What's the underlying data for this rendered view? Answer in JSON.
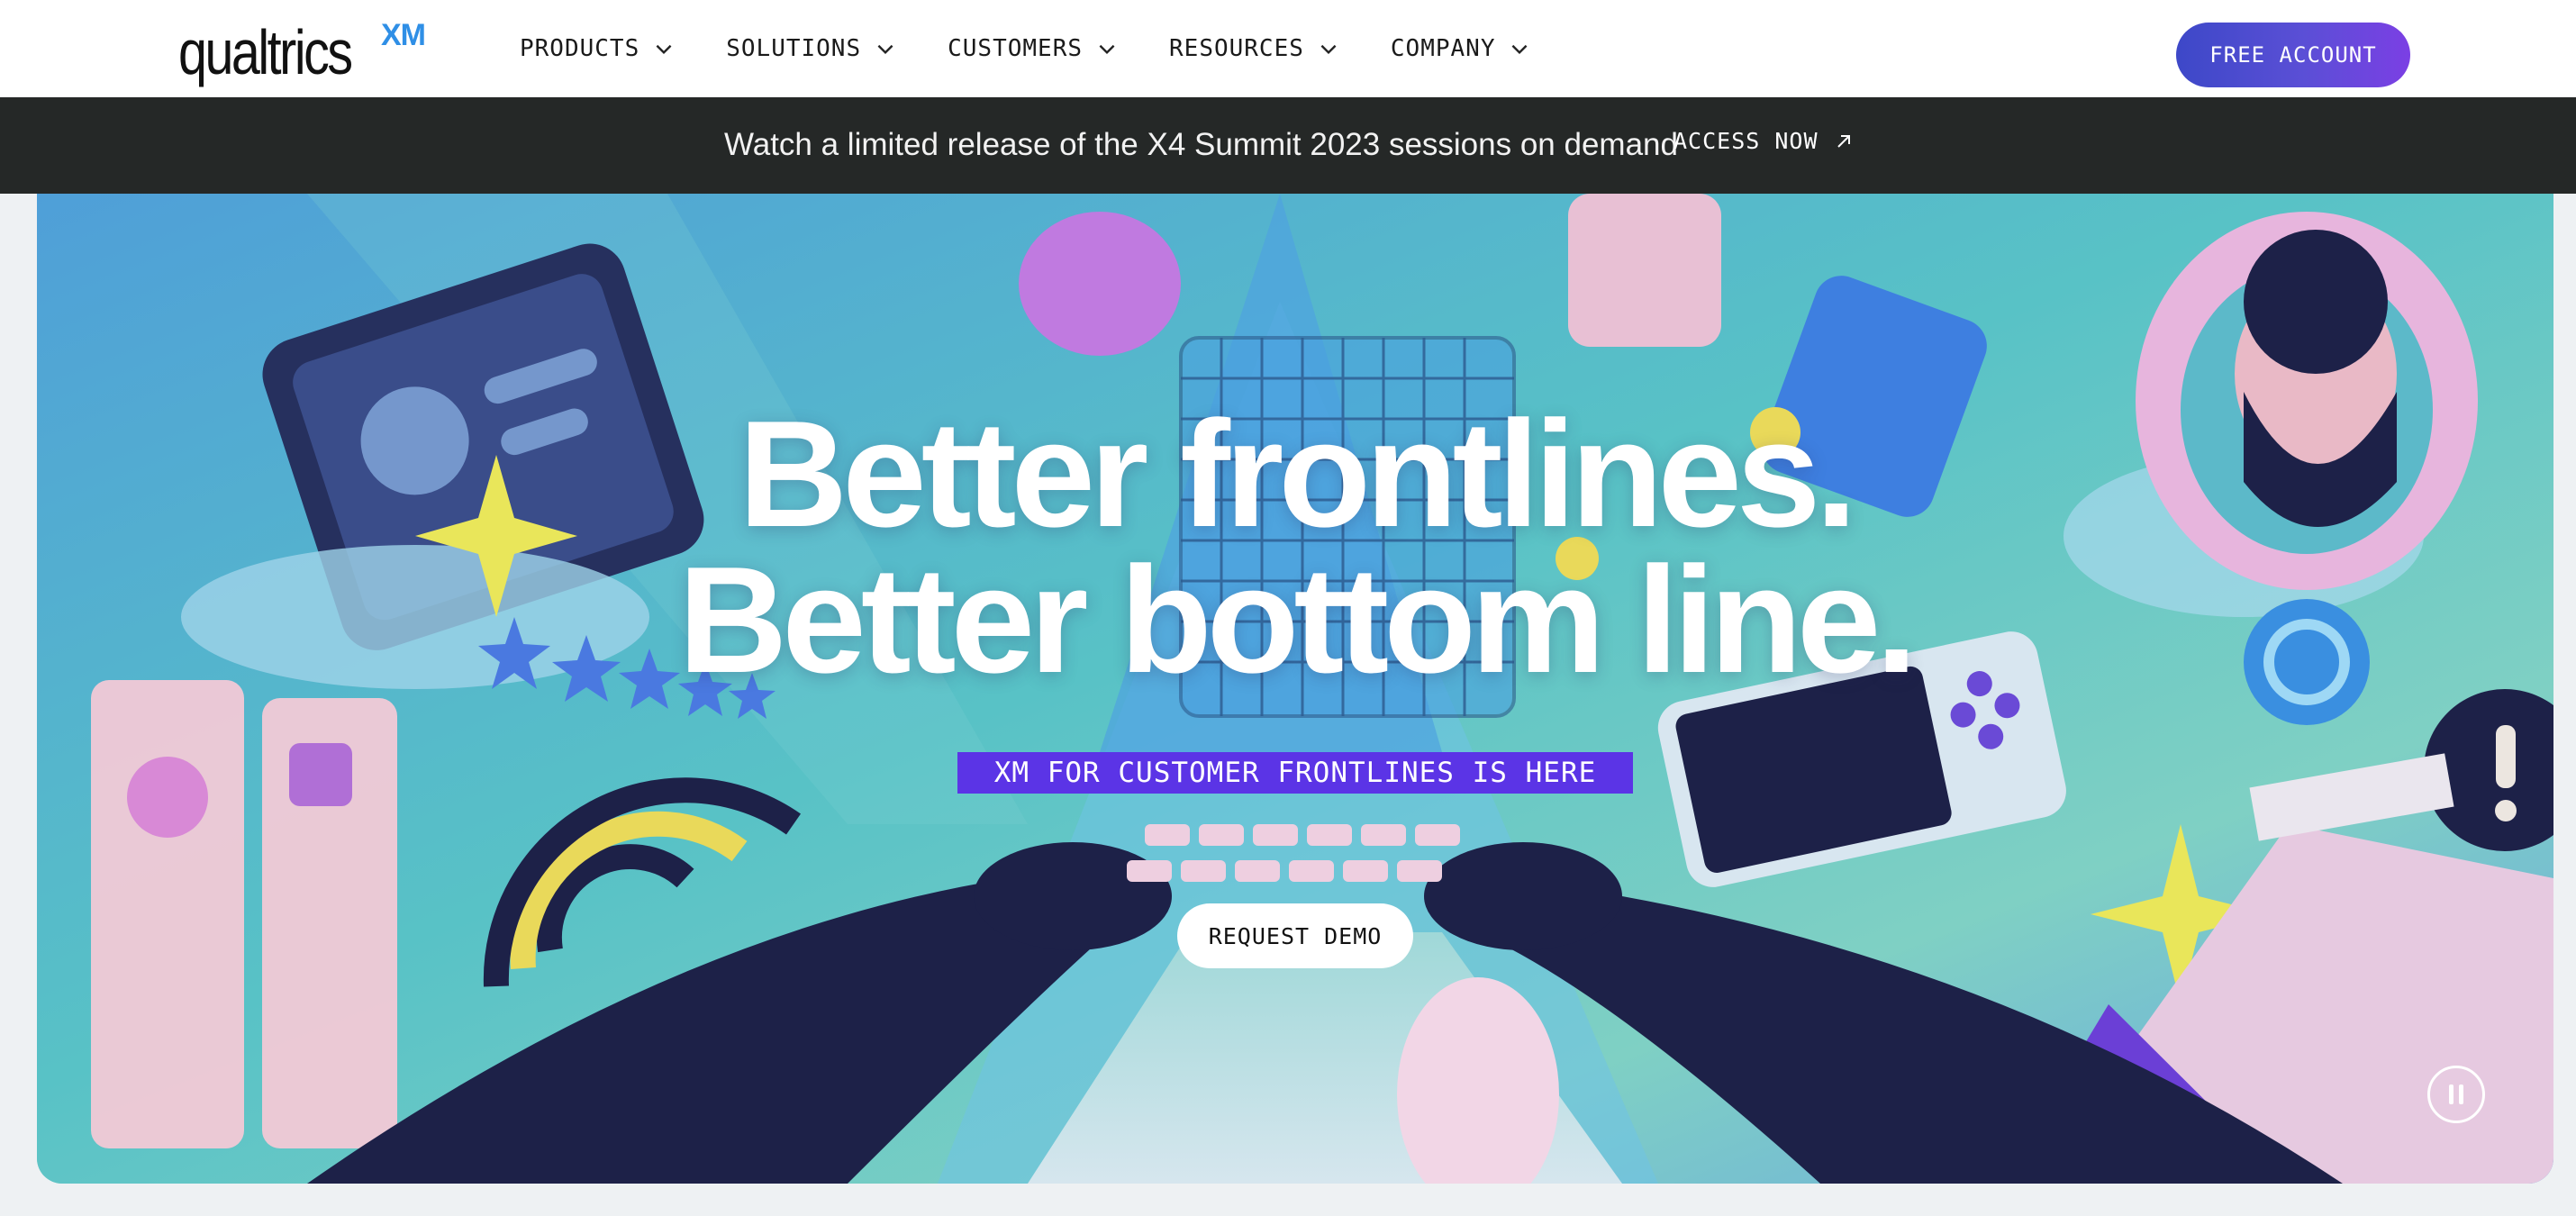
{
  "nav": {
    "logo_text": "qualtrics",
    "logo_badge": "XM",
    "menu": [
      {
        "label": "PRODUCTS",
        "icon": "chevron-down-icon"
      },
      {
        "label": "SOLUTIONS",
        "icon": "chevron-down-icon"
      },
      {
        "label": "CUSTOMERS",
        "icon": "chevron-down-icon"
      },
      {
        "label": "RESOURCES",
        "icon": "chevron-down-icon"
      },
      {
        "label": "COMPANY",
        "icon": "chevron-down-icon"
      }
    ],
    "cta_label": "FREE ACCOUNT"
  },
  "banner": {
    "text": "Watch a limited release of the X4 Summit 2023 sessions on demand",
    "link_label": "ACCESS NOW",
    "link_icon": "arrow-up-right-icon"
  },
  "hero": {
    "headline_line1": "Better frontlines.",
    "headline_line2": "Better bottom line.",
    "tagline": "XM FOR CUSTOMER FRONTLINES IS HERE",
    "cta_label": "REQUEST DEMO",
    "pause_icon": "pause-icon"
  },
  "colors": {
    "nav_bg": "#ffffff",
    "banner_bg": "#252827",
    "cta_gradient_start": "#3d48c8",
    "cta_gradient_end": "#7b3fe4",
    "tagline_bg": "#5b34e6",
    "logo_badge": "#2f8fe6",
    "page_bg": "#eef1f3"
  }
}
